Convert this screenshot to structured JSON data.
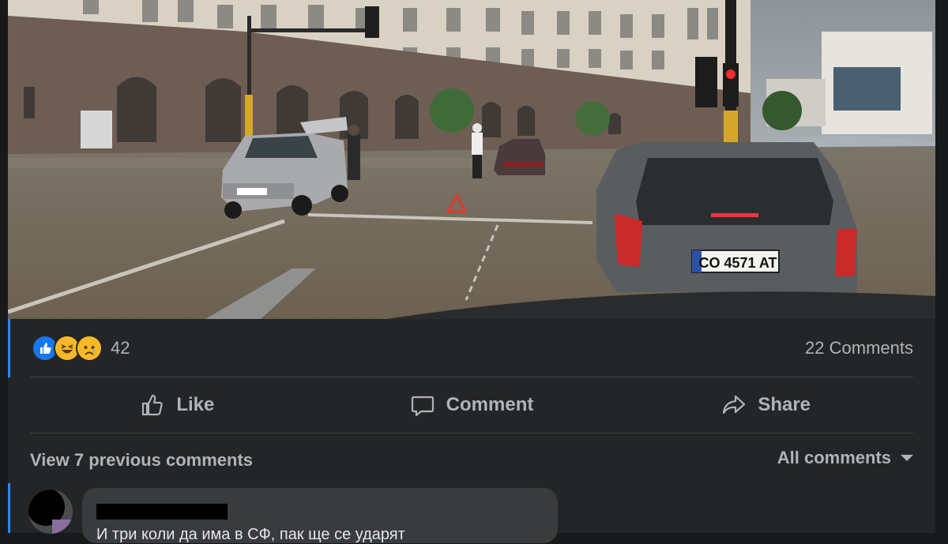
{
  "post": {
    "photo": {
      "plate_text": "CO 4571 AT"
    },
    "reactions": {
      "icons": [
        "like-icon",
        "haha-icon",
        "sad-icon"
      ],
      "count": "42"
    },
    "comments_count": "22 Comments",
    "actions": {
      "like": "Like",
      "comment": "Comment",
      "share": "Share"
    },
    "view_previous": "View 7 previous comments",
    "sort_label": "All comments"
  },
  "comment": {
    "text_partial": "И три коли да има в СФ, пак ще се ударят"
  },
  "colors": {
    "background": "#18191a",
    "card": "#242526",
    "accent": "#2d88ff",
    "text_secondary": "#b0b3b8"
  }
}
